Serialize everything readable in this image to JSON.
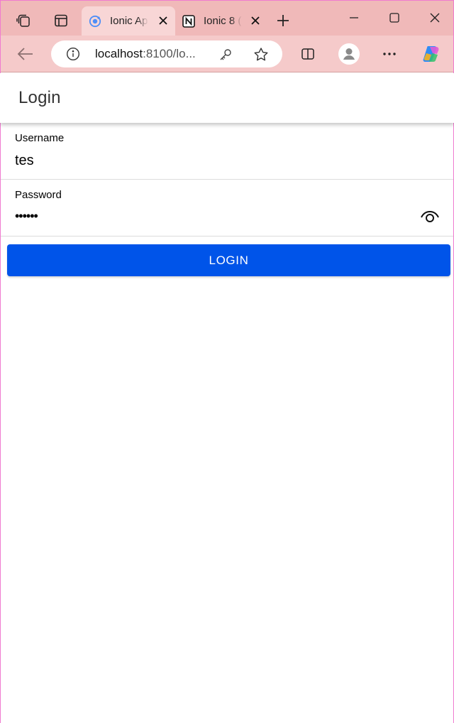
{
  "browser": {
    "tabs": [
      {
        "title": "Ionic App",
        "favicon": "ionic-logo-icon",
        "active": true
      },
      {
        "title": "Ionic 8 (",
        "favicon": "notion-logo-icon",
        "active": false
      }
    ],
    "address": {
      "host": "localhost",
      "rest": ":8100/lo..."
    },
    "colors": {
      "tabbar": "#f0b9b9",
      "addrbar": "#f5caca"
    }
  },
  "app": {
    "header_title": "Login",
    "username": {
      "label": "Username",
      "value": "tes"
    },
    "password": {
      "label": "Password",
      "value": "••••••"
    },
    "login_button": "LOGIN",
    "colors": {
      "primary": "#0054e9"
    }
  }
}
